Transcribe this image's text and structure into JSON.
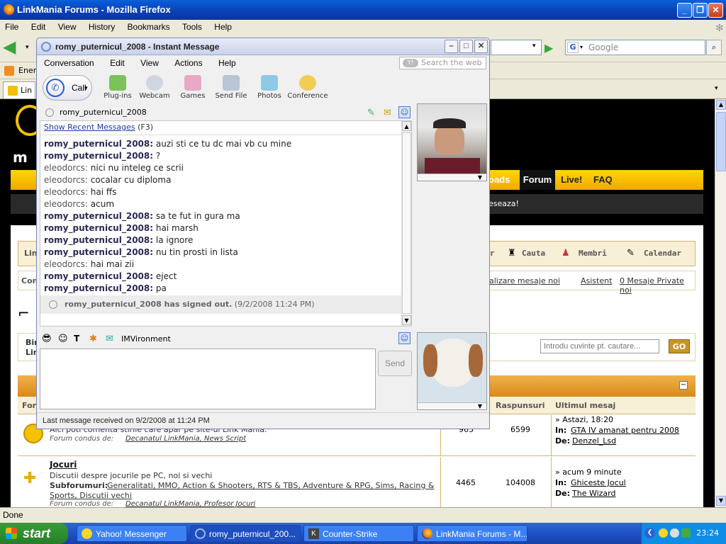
{
  "firefox": {
    "title": "LinkMania Forums - Mozilla Firefox",
    "menus": [
      "File",
      "Edit",
      "View",
      "History",
      "Bookmarks",
      "Tools",
      "Help"
    ],
    "search_placeholder": "Google",
    "bookmark_text": "Ener",
    "tab_label": "Lin",
    "status": "Done"
  },
  "forum": {
    "nav": [
      "oads",
      "Forum",
      "Live!",
      "FAQ"
    ],
    "notice": "eseaza!",
    "menu_items": [
      "r",
      "Cauta",
      "Membri",
      "Calendar"
    ],
    "links": [
      "alizare mesaje noi",
      "Asistent",
      "0 Mesaje Private noi"
    ],
    "left_labels": [
      "Lin",
      "Con",
      "Bin",
      "Lin"
    ],
    "search": {
      "placeholder": "Introdu cuvinte pt. cautare...",
      "go_label": "GO"
    },
    "col_headers": [
      "For",
      "Raspunsuri",
      "Ultimul mesaj"
    ],
    "rows": [
      {
        "desc": "Aici poti comenta stirile care apar pe site-ul Link Mania.",
        "mod_label": "Forum condus de:",
        "mods": "Decanatul LinkMania, News Script",
        "topics": "965",
        "replies": "6599",
        "last_when": "» Astazi, 18:20",
        "last_in_label": "In:",
        "last_in": "GTA IV amanat pentru 2008",
        "last_by_label": "De:",
        "last_by": "Denzel_Lsd"
      },
      {
        "title": "Jocuri",
        "desc": "Discutii despre jocurile pe PC, noi si vechi",
        "sub_label": "Subforumuri:",
        "subforums": "Generalitati, MMO, Action & Shooters, RTS & TBS, Adventure & RPG, Sims, Racing &",
        "subforums2": "Sports, Discutii vechi",
        "mod_label": "Forum condus de:",
        "mods": "Decanatul LinkMania, Profesor Jocuri",
        "topics": "4465",
        "replies": "104008",
        "last_when": "» acum 9 minute",
        "last_in_label": "In:",
        "last_in": "Ghiceste Jocul",
        "last_by_label": "De:",
        "last_by": "The Wizard"
      }
    ]
  },
  "im": {
    "title": "romy_puternicul_2008 - Instant Message",
    "menus": [
      "Conversation",
      "Edit",
      "View",
      "Actions",
      "Help"
    ],
    "search_placeholder": "Search the web",
    "call_label": "Call",
    "tools": [
      "Plug-ins",
      "Webcam",
      "Games",
      "Send File",
      "Photos",
      "Conference"
    ],
    "contact": "romy_puternicul_2008",
    "recent_link": "Show Recent Messages",
    "recent_key": "(F3)",
    "messages": [
      {
        "from": "romy_puternicul_2008:",
        "text": "auzi sti ce tu dc mai vb cu mine",
        "self": false
      },
      {
        "from": "romy_puternicul_2008:",
        "text": "?",
        "self": false
      },
      {
        "from": "eleodorcs:",
        "text": "nici nu inteleg ce scrii",
        "self": true
      },
      {
        "from": "eleodorcs:",
        "text": "cocalar cu diploma",
        "self": true
      },
      {
        "from": "eleodorcs:",
        "text": "hai ffs",
        "self": true
      },
      {
        "from": "eleodorcs:",
        "text": "acum",
        "self": true
      },
      {
        "from": "romy_puternicul_2008:",
        "text": "sa te fut in gura ma",
        "self": false
      },
      {
        "from": "romy_puternicul_2008:",
        "text": "hai marsh",
        "self": false
      },
      {
        "from": "romy_puternicul_2008:",
        "text": "la ignore",
        "self": false
      },
      {
        "from": "romy_puternicul_2008:",
        "text": "nu tin prosti in lista",
        "self": false
      },
      {
        "from": "eleodorcs:",
        "text": "hai mai zii",
        "self": true
      },
      {
        "from": "romy_puternicul_2008:",
        "text": "eject",
        "self": false
      },
      {
        "from": "romy_puternicul_2008:",
        "text": "pa",
        "self": false
      }
    ],
    "signed_out": "romy_puternicul_2008 has signed out.",
    "signed_out_time": "(9/2/2008 11:24 PM)",
    "imvironment": "IMVironment",
    "send_label": "Send",
    "status": "Last message received on 9/2/2008 at 11:24 PM"
  },
  "taskbar": {
    "start": "start",
    "tasks": [
      "Yahoo! Messenger",
      "romy_puternicul_200...",
      "Counter-Strike",
      "LinkMania Forums - M..."
    ],
    "clock": "23:24"
  }
}
